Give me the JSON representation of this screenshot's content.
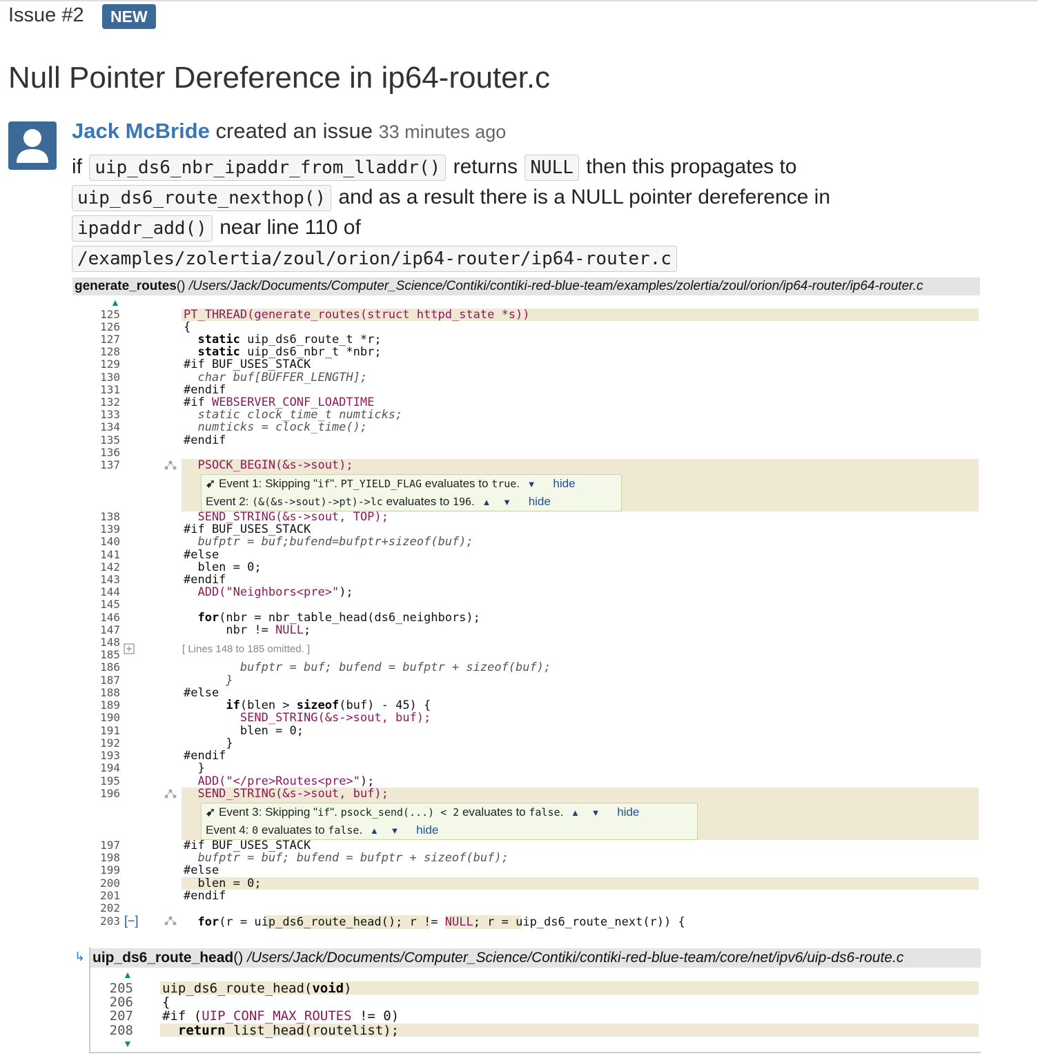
{
  "issue": {
    "number": "Issue #2",
    "badge": "NEW"
  },
  "title": "Null Pointer Dereference in ip64-router.c",
  "author": {
    "name": "Jack McBride",
    "action": "created an issue",
    "time_ago": "33 minutes ago"
  },
  "description": {
    "w1": "if",
    "c1": "uip_ds6_nbr_ipaddr_from_lladdr()",
    "w2": "returns",
    "c2": "NULL",
    "w3": "then this propagates to",
    "c3": "uip_ds6_route_nexthop()",
    "w4": "and as a result there is a NULL pointer dereference in",
    "c4": "ipaddr_add()",
    "w5": "near line 110 of",
    "c5": "/examples/zolertia/zoul/orion/ip64-router/ip64-router.c"
  },
  "file1": {
    "function": "generate_routes",
    "parens": "()",
    "path": "/Users/Jack/Documents/Computer_Science/Contiki/contiki-red-blue-team/examples/zolertia/zoul/orion/ip64-router/ip64-router.c"
  },
  "file2": {
    "function": "uip_ds6_route_head",
    "parens": "()",
    "path": "/Users/Jack/Documents/Computer_Science/Contiki/contiki-red-blue-team/core/net/ipv6/uip-ds6-route.c"
  },
  "events": {
    "e1": {
      "label": "Event 1:",
      "text1": "Skipping \"",
      "code1": "if",
      "text2": "\".",
      "code2": "PT_YIELD_FLAG",
      "text3": "evaluates to",
      "code3": "true",
      "text4": ".",
      "hide": "hide"
    },
    "e2": {
      "label": "Event 2:",
      "code1": "(&(&s->sout)->pt)->lc",
      "text1": "evaluates to",
      "code2": "196",
      "text2": ".",
      "hide": "hide"
    },
    "e3": {
      "label": "Event 3:",
      "text1": "Skipping \"",
      "code1": "if",
      "text2": "\".",
      "code2": "psock_send(...) < 2",
      "text3": "evaluates to",
      "code3": "false",
      "text4": ".",
      "hide": "hide"
    },
    "e4": {
      "label": "Event 4:",
      "code1": "0",
      "text1": "evaluates to",
      "code2": "false",
      "text2": ".",
      "hide": "hide"
    }
  },
  "omitted": "[ Lines 148 to 185 omitted. ]",
  "collapse_label": "[−]",
  "line_numbers": {
    "l125": "125",
    "l126": "126",
    "l127": "127",
    "l128": "128",
    "l129": "129",
    "l130": "130",
    "l131": "131",
    "l132": "132",
    "l133": "133",
    "l134": "134",
    "l135": "135",
    "l136": "136",
    "l137": "137",
    "l138": "138",
    "l139": "139",
    "l140": "140",
    "l141": "141",
    "l142": "142",
    "l143": "143",
    "l144": "144",
    "l145": "145",
    "l146": "146",
    "l147": "147",
    "l148": "148",
    "l185": "185",
    "l186": "186",
    "l187": "187",
    "l188": "188",
    "l189": "189",
    "l190": "190",
    "l191": "191",
    "l192": "192",
    "l193": "193",
    "l194": "194",
    "l195": "195",
    "l196": "196",
    "l197": "197",
    "l198": "198",
    "l199": "199",
    "l200": "200",
    "l201": "201",
    "l202": "202",
    "l203": "203",
    "l205": "205",
    "l206": "206",
    "l207": "207",
    "l208": "208"
  },
  "code": {
    "c125": "PT_THREAD(generate_routes(struct httpd_state *s))",
    "c126": "{",
    "c127a": "  static",
    "c127b": " uip_ds6_route_t *r;",
    "c128a": "  static",
    "c128b": " uip_ds6_nbr_t *nbr;",
    "c129": "#if BUF_USES_STACK",
    "c130": "  char buf[BUFFER_LENGTH];",
    "c131": "#endif",
    "c132a": "#if ",
    "c132b": "WEBSERVER_CONF_LOADTIME",
    "c133": "  static clock_time_t numticks;",
    "c134": "  numticks = clock_time();",
    "c135": "#endif",
    "c137": "  PSOCK_BEGIN(&s->sout);",
    "c138": "  SEND_STRING(&s->sout, TOP);",
    "c139": "#if BUF_USES_STACK",
    "c140": "  bufptr = buf;bufend=bufptr+sizeof(buf);",
    "c141": "#else",
    "c142": "  blen = 0;",
    "c143": "#endif",
    "c144a": "  ADD(",
    "c144b": "\"Neighbors<pre>\"",
    "c144c": ");",
    "c146a": "  for",
    "c146b": "(nbr = nbr_table_head(ds6_neighbors);",
    "c147a": "      nbr != ",
    "c147b": "NULL",
    "c147c": ";",
    "c186": "        bufptr = buf; bufend = bufptr + sizeof(buf);",
    "c187": "      }",
    "c188": "#else",
    "c189a": "      if",
    "c189b": "(blen > ",
    "c189c": "sizeof",
    "c189d": "(buf) - 45) {",
    "c190a": "        ",
    "c190b": "SEND_STRING(&s->sout, buf);",
    "c191": "        blen = 0;",
    "c192": "      }",
    "c193": "#endif",
    "c194": "  }",
    "c195a": "  ADD(",
    "c195b": "\"</pre>Routes<pre>\"",
    "c195c": ");",
    "c196": "  SEND_STRING(&s->sout, buf);",
    "c197": "#if BUF_USES_STACK",
    "c198": "  bufptr = buf; bufend = bufptr + sizeof(buf);",
    "c199": "#else",
    "c200": "  blen = 0;",
    "c201": "#endif",
    "c203a": "  for",
    "c203b": "(r = ",
    "c203c": "uip_ds6_route_head();",
    "c203d": " r != ",
    "c203e": "NULL",
    "c203f": "; r = uip_ds6_route_next(r)) {",
    "c205a": "uip_ds6_route_head(",
    "c205b": "void",
    "c205c": ")",
    "c206": "{",
    "c207a": "#if (",
    "c207b": "UIP_CONF_MAX_ROUTES",
    "c207c": " != 0)",
    "c208a": "  return",
    "c208b": " list_head(routelist);"
  }
}
